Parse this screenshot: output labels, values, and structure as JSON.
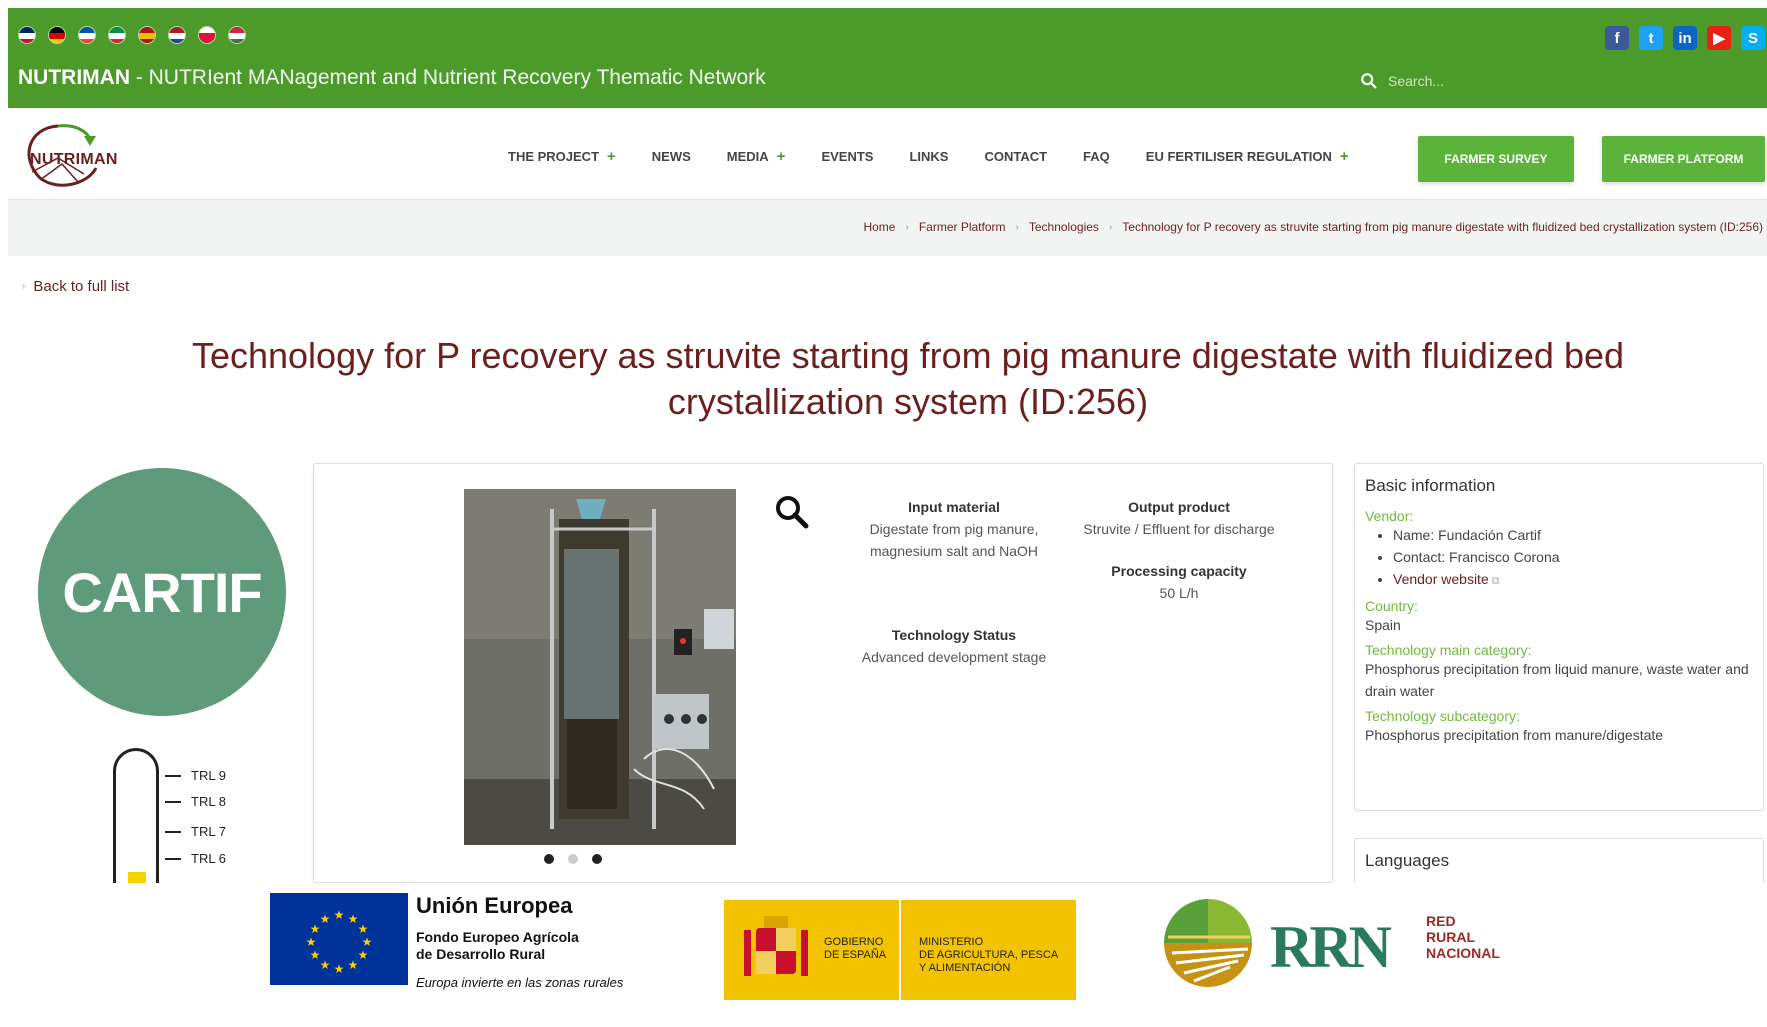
{
  "header": {
    "flags": [
      {
        "name": "uk-flag",
        "colors": [
          "#012169",
          "#ffffff",
          "#c8102e"
        ]
      },
      {
        "name": "de-flag",
        "colors": [
          "#000000",
          "#dd0000",
          "#ffce00"
        ]
      },
      {
        "name": "fr-flag",
        "colors": [
          "#0055a4",
          "#ffffff",
          "#ef4135"
        ]
      },
      {
        "name": "it-flag",
        "colors": [
          "#009246",
          "#ffffff",
          "#ce2b37"
        ]
      },
      {
        "name": "es-flag",
        "colors": [
          "#aa151b",
          "#f1bf00",
          "#aa151b"
        ]
      },
      {
        "name": "nl-flag",
        "colors": [
          "#ae1c28",
          "#ffffff",
          "#21468b"
        ]
      },
      {
        "name": "pl-flag",
        "colors": [
          "#ffffff",
          "#dc143c",
          "#dc143c"
        ]
      },
      {
        "name": "hu-flag",
        "colors": [
          "#ce2939",
          "#ffffff",
          "#477050"
        ]
      }
    ],
    "brand": "NUTRIMAN",
    "tagline": " - NUTRIent MANagement and Nutrient Recovery Thematic Network",
    "search_placeholder": "Search...",
    "social": [
      {
        "name": "facebook-icon",
        "glyph": "f",
        "color": "#3b5998"
      },
      {
        "name": "twitter-icon",
        "glyph": "t",
        "color": "#1da1f2"
      },
      {
        "name": "linkedin-icon",
        "glyph": "in",
        "color": "#0a66c2"
      },
      {
        "name": "youtube-icon",
        "glyph": "▶",
        "color": "#e62117"
      },
      {
        "name": "skype-icon",
        "glyph": "S",
        "color": "#00aff0"
      }
    ]
  },
  "nav": {
    "logo_text": "NUTRIMAN",
    "items": [
      {
        "label": "THE PROJECT",
        "plus": true
      },
      {
        "label": "NEWS",
        "plus": false
      },
      {
        "label": "MEDIA",
        "plus": true
      },
      {
        "label": "EVENTS",
        "plus": false
      },
      {
        "label": "LINKS",
        "plus": false
      },
      {
        "label": "CONTACT",
        "plus": false
      },
      {
        "label": "FAQ",
        "plus": false
      },
      {
        "label": "EU FERTILISER REGULATION",
        "plus": true
      }
    ],
    "farmer_survey": "FARMER SURVEY",
    "farmer_platform": "FARMER PLATFORM"
  },
  "breadcrumb": [
    "Home",
    "Farmer Platform",
    "Technologies",
    "Technology for P recovery as struvite starting from pig manure digestate with fluidized bed crystallization system (ID:256)"
  ],
  "back_link": "Back to full list",
  "title_line1": "Technology for P recovery as struvite starting from pig manure digestate with fluidized bed",
  "title_line2": "crystallization system (ID:256)",
  "vendor_logo": "CARTIF",
  "trl": [
    "TRL 9",
    "TRL 8",
    "TRL 7",
    "TRL 6"
  ],
  "specs": {
    "input_h": "Input material",
    "input_v1": "Digestate from pig manure,",
    "input_v2": "magnesium salt and NaOH",
    "output_h": "Output product",
    "output_v": "Struvite / Effluent for discharge",
    "capacity_h": "Processing capacity",
    "capacity_v": "50 L/h",
    "status_h": "Technology Status",
    "status_v": "Advanced development stage"
  },
  "basic_info": {
    "title": "Basic information",
    "vendor_label": "Vendor:",
    "vendor_name": "Name: Fundación Cartif",
    "vendor_contact": "Contact: Francisco Corona",
    "vendor_website": "Vendor website",
    "country_label": "Country:",
    "country": "Spain",
    "main_cat_label": "Technology main category:",
    "main_cat": "Phosphorus precipitation from liquid manure, waste water and drain water",
    "sub_cat_label": "Technology subcategory:",
    "sub_cat": "Phosphorus precipitation from manure/digestate"
  },
  "languages_title": "Languages",
  "footer": {
    "eu_title": "Unión Europea",
    "eu_sub1": "Fondo Europeo Agrícola",
    "eu_sub2": "de Desarrollo Rural",
    "eu_motto": "Europa invierte en las zonas rurales",
    "gob1": "GOBIERNO",
    "gob2": "DE ESPAÑA",
    "min1": "MINISTERIO",
    "min2": "DE AGRICULTURA, PESCA",
    "min3": "Y ALIMENTACIÓN",
    "rrn": "RRN",
    "red": "RED",
    "rural": "RURAL",
    "nacional": "NACIONAL"
  }
}
